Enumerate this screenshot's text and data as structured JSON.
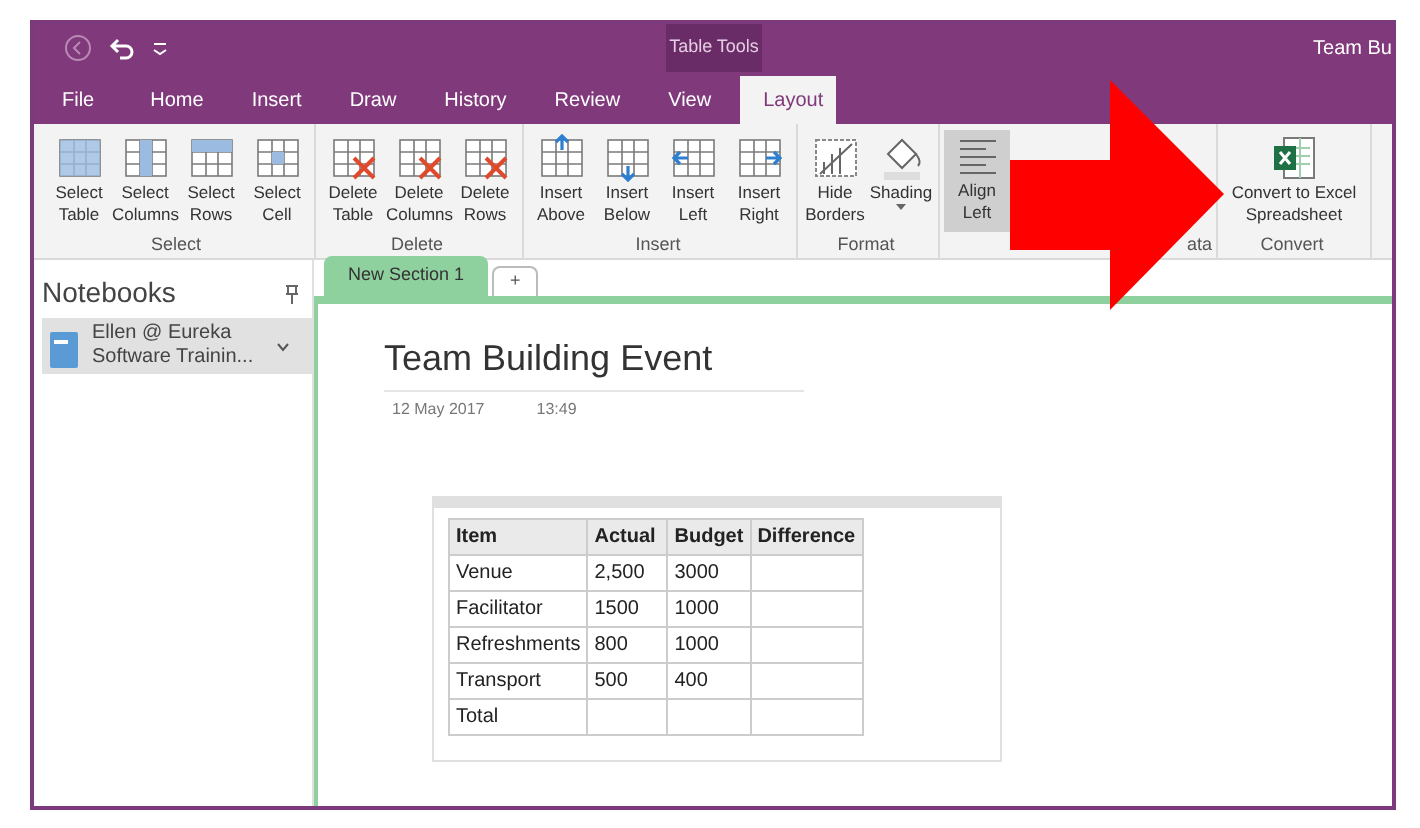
{
  "window": {
    "title": "Team Bu",
    "contextual_tab": "Table Tools"
  },
  "menu_tabs": [
    {
      "label": "File",
      "selected": false
    },
    {
      "label": "Home",
      "selected": false
    },
    {
      "label": "Insert",
      "selected": false
    },
    {
      "label": "Draw",
      "selected": false
    },
    {
      "label": "History",
      "selected": false
    },
    {
      "label": "Review",
      "selected": false
    },
    {
      "label": "View",
      "selected": false
    },
    {
      "label": "Layout",
      "selected": true
    }
  ],
  "ribbon_groups": [
    {
      "label": "Select",
      "buttons": [
        {
          "label": "Select Table"
        },
        {
          "label": "Select Columns"
        },
        {
          "label": "Select Rows"
        },
        {
          "label": "Select Cell"
        }
      ]
    },
    {
      "label": "Delete",
      "buttons": [
        {
          "label": "Delete Table"
        },
        {
          "label": "Delete Columns"
        },
        {
          "label": "Delete Rows"
        }
      ]
    },
    {
      "label": "Insert",
      "buttons": [
        {
          "label": "Insert Above"
        },
        {
          "label": "Insert Below"
        },
        {
          "label": "Insert Left"
        },
        {
          "label": "Insert Right"
        }
      ]
    },
    {
      "label": "Format",
      "buttons": [
        {
          "label": "Hide Borders"
        },
        {
          "label": "Shading",
          "dropdown": true
        }
      ]
    },
    {
      "buttons": [
        {
          "label": "Align Left",
          "selected": true
        }
      ]
    },
    {
      "label": "ata"
    },
    {
      "label": "Convert",
      "buttons": [
        {
          "label": "Convert to Excel Spreadsheet"
        }
      ]
    }
  ],
  "sidebar": {
    "title": "Notebooks",
    "notebook": "Ellen @ Eureka Software Trainin..."
  },
  "section_tabs": [
    {
      "label": "New Section 1",
      "selected": true
    },
    {
      "label": "+",
      "selected": false
    }
  ],
  "page": {
    "title": "Team Building Event",
    "date": "12 May 2017",
    "time": "13:49"
  },
  "table": {
    "columns": [
      "Item",
      "Actual",
      "Budget",
      "Difference"
    ],
    "rows": [
      [
        "Venue",
        "2,500",
        "3000",
        ""
      ],
      [
        "Facilitator",
        "1500",
        "1000",
        ""
      ],
      [
        "Refreshments",
        "800",
        "1000",
        ""
      ],
      [
        "Transport",
        "500",
        "400",
        ""
      ],
      [
        "Total",
        "",
        "",
        ""
      ]
    ]
  }
}
